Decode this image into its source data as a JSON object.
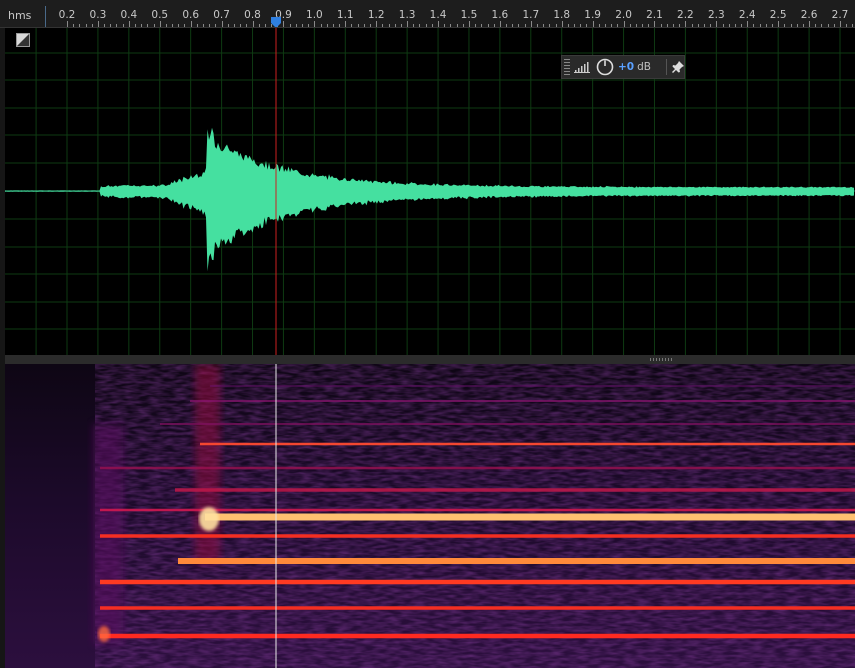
{
  "ruler": {
    "unit_label": "hms",
    "ticks": [
      "0.2",
      "0.3",
      "0.4",
      "0.5",
      "0.6",
      "0.7",
      "0.8",
      "0.9",
      "1.0",
      "1.1",
      "1.2",
      "1.3",
      "1.4",
      "1.5",
      "1.6",
      "1.7",
      "1.8",
      "1.9",
      "2.0",
      "2.1",
      "2.2",
      "2.3",
      "2.4",
      "2.5",
      "2.6",
      "2.7"
    ]
  },
  "playhead": {
    "time_s": 0.885
  },
  "hud": {
    "gain_value": "+0",
    "gain_unit": "dB"
  },
  "colors": {
    "waveform": "#45e0a0",
    "grid": "#0e3a12",
    "cursor_wave": "#cc2020",
    "cursor_spec": "#e8e8e8",
    "playhead_marker": "#2f7fe0"
  },
  "icons": {
    "corner": "spectral-toggle-icon",
    "meter": "level-meter-icon",
    "knob": "gain-knob-icon",
    "pin": "pin-icon"
  }
}
